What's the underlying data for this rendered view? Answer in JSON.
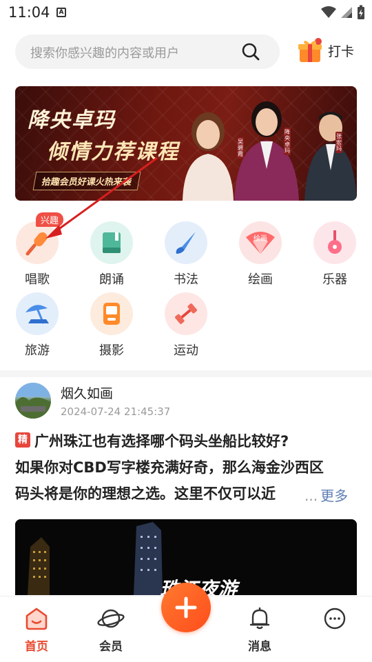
{
  "status_bar": {
    "time": "11:04",
    "notification_letter": "A"
  },
  "search": {
    "placeholder": "搜索你感兴趣的内容或用户"
  },
  "checkin": {
    "label": "打卡"
  },
  "banner": {
    "title_line1": "降央卓玛",
    "title_line2": "倾情力荐课程",
    "tag": "拾趣会员好课火热来袭",
    "person_tags": [
      "吴碧霞",
      "降央卓玛",
      "张宏玛"
    ]
  },
  "interest_badge": "兴趣",
  "categories": [
    {
      "label": "唱歌",
      "icon": "microphone-icon",
      "bg": "#fde8df"
    },
    {
      "label": "朗诵",
      "icon": "book-icon",
      "bg": "#dff4ee"
    },
    {
      "label": "书法",
      "icon": "brush-icon",
      "bg": "#e4eefb"
    },
    {
      "label": "绘画",
      "icon": "fan-icon",
      "bg": "#fde4e4",
      "icon_text": "绘画"
    },
    {
      "label": "乐器",
      "icon": "ukulele-icon",
      "bg": "#fde6ea"
    },
    {
      "label": "旅游",
      "icon": "beach-umbrella-icon",
      "bg": "#e3eefb"
    },
    {
      "label": "摄影",
      "icon": "camera-icon",
      "bg": "#fdebde"
    },
    {
      "label": "运动",
      "icon": "dumbbell-icon",
      "bg": "#fde6e4"
    }
  ],
  "post": {
    "author": "烟久如画",
    "time": "2024-07-24 21:45:37",
    "badge": "精",
    "title": "广州珠江也有选择哪个码头坐船比较好?",
    "body_line1": "如果你对CBD写字楼充满好奇，那么海金沙西区",
    "body_line2": "码头将是你的理想之选。这里不仅可以近",
    "ellipsis": "...",
    "more": "更多",
    "image_text": "珠江夜游"
  },
  "bottom_nav": {
    "home": "首页",
    "member": "会员",
    "messages": "消息",
    "profile": ""
  },
  "colors": {
    "accent": "#e84a2f",
    "link": "#5d7db3"
  }
}
